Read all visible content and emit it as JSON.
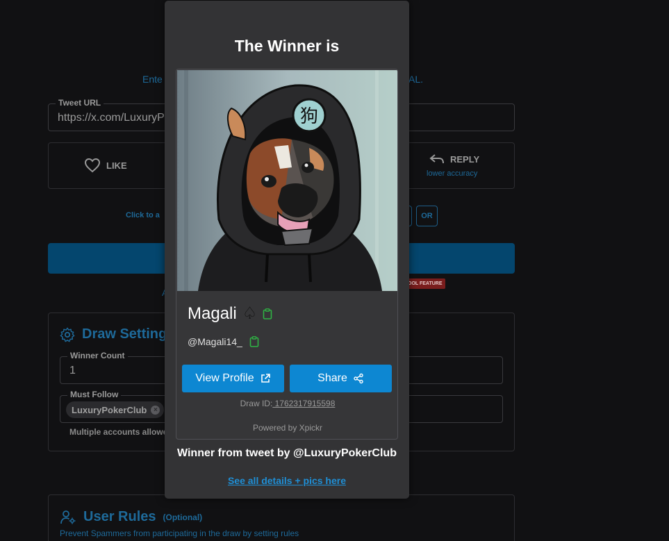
{
  "background": {
    "instruction_left": "Ente",
    "instruction_right": "AL.",
    "tweet_url": {
      "label": "Tweet URL",
      "value": "https://x.com/LuxuryP"
    },
    "like_label": "LIKE",
    "reply_label": "REPLY",
    "reply_sub": "lower accuracy",
    "click_add": "Click to a",
    "or_label": "OR",
    "pool_feature": "OOL FEATURE",
    "faint_a": "A",
    "draw_settings": {
      "title": "Draw Setting",
      "winner_count": {
        "label": "Winner Count",
        "value": "1"
      },
      "must_follow": {
        "label": "Must Follow",
        "chip": "LuxuryPokerClub"
      },
      "multiple_note": "Multiple accounts allowe"
    },
    "user_rules": {
      "title": "User Rules",
      "optional": "(Optional)",
      "subtitle": "Prevent Spammers from participating in the draw by setting rules"
    }
  },
  "modal": {
    "title": "The Winner is",
    "avatar_glyph": "狗",
    "winner_name": "Magali",
    "winner_suffix": "♤",
    "handle": "@Magali14_",
    "view_profile": "View Profile",
    "share": "Share",
    "draw_id_label": "Draw ID:",
    "draw_id": " 1762317915598",
    "powered_by": "Powered by Xpickr",
    "winner_from": "Winner from tweet by @LuxuryPokerClub",
    "see_all": "See all details + pics here"
  },
  "colors": {
    "accent": "#0d87d2",
    "copy_icon": "#2fb344",
    "modal_bg": "#333335",
    "page_bg": "#111113"
  }
}
